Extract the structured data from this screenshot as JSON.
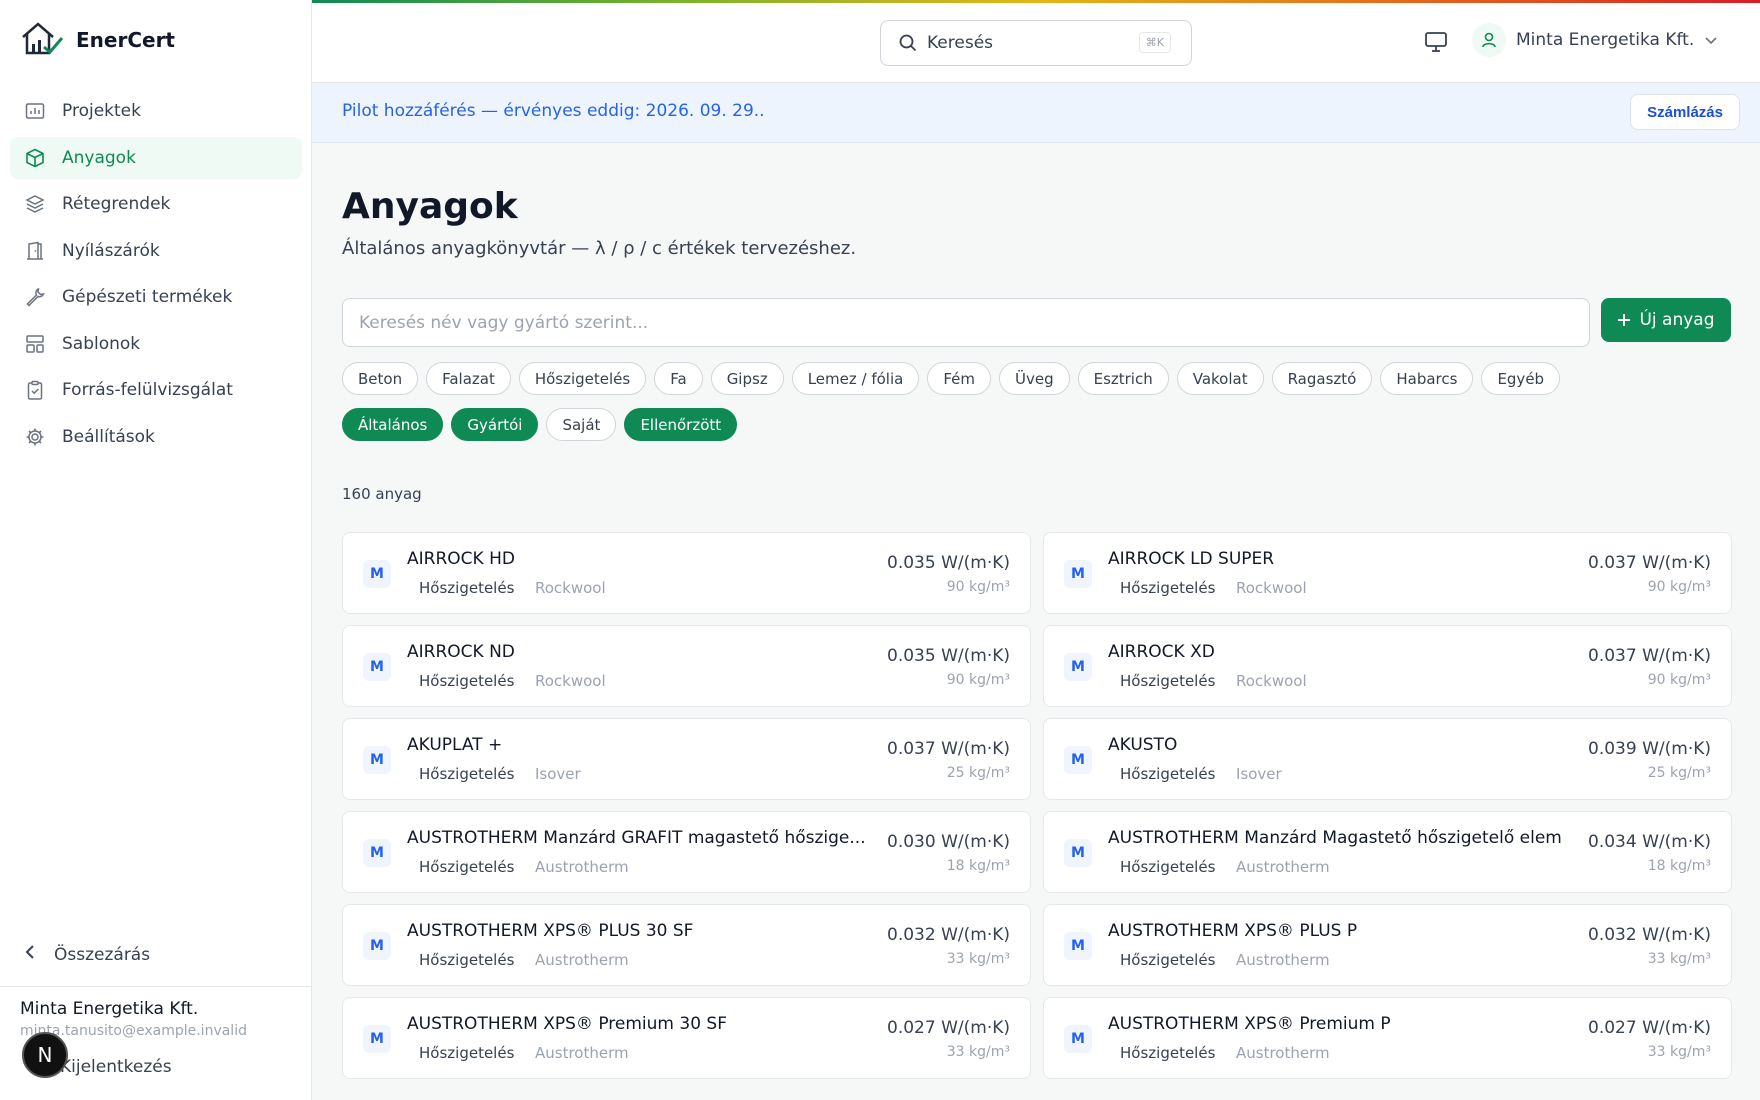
{
  "app": {
    "name": "EnerCert"
  },
  "nav": {
    "items": [
      {
        "label": "Projektek",
        "icon": "folder-chart-icon",
        "active": false
      },
      {
        "label": "Anyagok",
        "icon": "cube-icon",
        "active": true
      },
      {
        "label": "Rétegrendek",
        "icon": "layers-icon",
        "active": false
      },
      {
        "label": "Nyílászárók",
        "icon": "door-icon",
        "active": false
      },
      {
        "label": "Gépészeti termékek",
        "icon": "wrench-icon",
        "active": false
      },
      {
        "label": "Sablonok",
        "icon": "template-icon",
        "active": false
      },
      {
        "label": "Forrás-felülvizsgálat",
        "icon": "clipboard-check-icon",
        "active": false
      },
      {
        "label": "Beállítások",
        "icon": "gear-icon",
        "active": false
      }
    ],
    "collapse_label": "Összezárás"
  },
  "account": {
    "org": "Minta Energetika Kft.",
    "email": "minta.tanusito@example.invalid",
    "logout": "Kijelentkezés",
    "badge": "N"
  },
  "topbar": {
    "search_label": "Keresés",
    "search_shortcut": "⌘K",
    "user_name": "Minta Energetika Kft."
  },
  "banner": {
    "text": "Pilot hozzáférés — érvényes eddig: 2026. 09. 29..",
    "billing_label": "Számlázás"
  },
  "page": {
    "title": "Anyagok",
    "subtitle": "Általános anyagkönyvtár — λ / ρ / c értékek tervezéshez.",
    "search_placeholder": "Keresés név vagy gyártó szerint...",
    "new_button": "Új anyag",
    "count": "160 anyag"
  },
  "category_chips": [
    "Beton",
    "Falazat",
    "Hőszigetelés",
    "Fa",
    "Gipsz",
    "Lemez / fólia",
    "Fém",
    "Üveg",
    "Esztrich",
    "Vakolat",
    "Ragasztó",
    "Habarcs",
    "Egyéb"
  ],
  "source_chips": [
    {
      "label": "Általános",
      "on": true
    },
    {
      "label": "Gyártói",
      "on": true
    },
    {
      "label": "Saját",
      "on": false
    },
    {
      "label": "Ellenőrzött",
      "on": true
    }
  ],
  "materials": [
    {
      "badge": "M",
      "name": "AIRROCK HD",
      "category": "Hőszigetelés",
      "manufacturer": "Rockwool",
      "lambda": "0.035 W/(m·K)",
      "density": "90 kg/m³"
    },
    {
      "badge": "M",
      "name": "AIRROCK LD SUPER",
      "category": "Hőszigetelés",
      "manufacturer": "Rockwool",
      "lambda": "0.037 W/(m·K)",
      "density": "90 kg/m³"
    },
    {
      "badge": "M",
      "name": "AIRROCK ND",
      "category": "Hőszigetelés",
      "manufacturer": "Rockwool",
      "lambda": "0.035 W/(m·K)",
      "density": "90 kg/m³"
    },
    {
      "badge": "M",
      "name": "AIRROCK XD",
      "category": "Hőszigetelés",
      "manufacturer": "Rockwool",
      "lambda": "0.037 W/(m·K)",
      "density": "90 kg/m³"
    },
    {
      "badge": "M",
      "name": "AKUPLAT +",
      "category": "Hőszigetelés",
      "manufacturer": "Isover",
      "lambda": "0.037 W/(m·K)",
      "density": "25 kg/m³"
    },
    {
      "badge": "M",
      "name": "AKUSTO",
      "category": "Hőszigetelés",
      "manufacturer": "Isover",
      "lambda": "0.039 W/(m·K)",
      "density": "25 kg/m³"
    },
    {
      "badge": "M",
      "name": "AUSTROTHERM Manzárd GRAFIT magastető hőszige...",
      "category": "Hőszigetelés",
      "manufacturer": "Austrotherm",
      "lambda": "0.030 W/(m·K)",
      "density": "18 kg/m³"
    },
    {
      "badge": "M",
      "name": "AUSTROTHERM Manzárd Magastető hőszigetelő elem",
      "category": "Hőszigetelés",
      "manufacturer": "Austrotherm",
      "lambda": "0.034 W/(m·K)",
      "density": "18 kg/m³"
    },
    {
      "badge": "M",
      "name": "AUSTROTHERM XPS® PLUS 30 SF",
      "category": "Hőszigetelés",
      "manufacturer": "Austrotherm",
      "lambda": "0.032 W/(m·K)",
      "density": "33 kg/m³"
    },
    {
      "badge": "M",
      "name": "AUSTROTHERM XPS® PLUS P",
      "category": "Hőszigetelés",
      "manufacturer": "Austrotherm",
      "lambda": "0.032 W/(m·K)",
      "density": "33 kg/m³"
    },
    {
      "badge": "M",
      "name": "AUSTROTHERM XPS® Premium 30 SF",
      "category": "Hőszigetelés",
      "manufacturer": "Austrotherm",
      "lambda": "0.027 W/(m·K)",
      "density": "33 kg/m³"
    },
    {
      "badge": "M",
      "name": "AUSTROTHERM XPS® Premium P",
      "category": "Hőszigetelés",
      "manufacturer": "Austrotherm",
      "lambda": "0.027 W/(m·K)",
      "density": "33 kg/m³"
    }
  ],
  "colors": {
    "accent": "#0f8a55",
    "link": "#2563eb"
  }
}
